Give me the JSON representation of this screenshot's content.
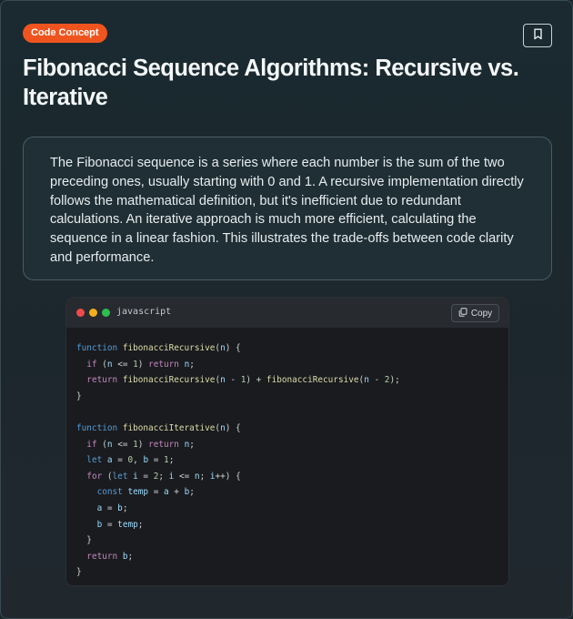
{
  "badge": "Code Concept",
  "title": "Fibonacci Sequence Algorithms: Recursive vs. Iterative",
  "description": "The Fibonacci sequence is a series where each number is the sum of the two preceding ones, usually starting with 0 and 1. A recursive implementation directly follows the mathematical definition, but it's inefficient due to redundant calculations. An iterative approach is much more efficient, calculating the sequence in a linear fashion. This illustrates the trade-offs between code clarity and performance.",
  "code_block": {
    "language": "javascript",
    "copy_label": "Copy",
    "lines": [
      [
        [
          "kw2",
          "function "
        ],
        [
          "fn",
          "fibonacciRecursive"
        ],
        [
          "p",
          "("
        ],
        [
          "var",
          "n"
        ],
        [
          "p",
          ") {"
        ]
      ],
      [
        [
          "p",
          "  "
        ],
        [
          "kw",
          "if"
        ],
        [
          "p",
          " ("
        ],
        [
          "var",
          "n"
        ],
        [
          "p",
          " <= "
        ],
        [
          "num",
          "1"
        ],
        [
          "p",
          ") "
        ],
        [
          "kw",
          "return"
        ],
        [
          "p",
          " "
        ],
        [
          "var",
          "n"
        ],
        [
          "p",
          ";"
        ]
      ],
      [
        [
          "p",
          "  "
        ],
        [
          "kw",
          "return"
        ],
        [
          "p",
          " "
        ],
        [
          "fn",
          "fibonacciRecursive"
        ],
        [
          "p",
          "("
        ],
        [
          "var",
          "n"
        ],
        [
          "p",
          " - "
        ],
        [
          "num",
          "1"
        ],
        [
          "p",
          ") + "
        ],
        [
          "fn",
          "fibonacciRecursive"
        ],
        [
          "p",
          "("
        ],
        [
          "var",
          "n"
        ],
        [
          "p",
          " - "
        ],
        [
          "num",
          "2"
        ],
        [
          "p",
          ");"
        ]
      ],
      [
        [
          "p",
          "}"
        ]
      ],
      [],
      [
        [
          "kw2",
          "function "
        ],
        [
          "fn",
          "fibonacciIterative"
        ],
        [
          "p",
          "("
        ],
        [
          "var",
          "n"
        ],
        [
          "p",
          ") {"
        ]
      ],
      [
        [
          "p",
          "  "
        ],
        [
          "kw",
          "if"
        ],
        [
          "p",
          " ("
        ],
        [
          "var",
          "n"
        ],
        [
          "p",
          " <= "
        ],
        [
          "num",
          "1"
        ],
        [
          "p",
          ") "
        ],
        [
          "kw",
          "return"
        ],
        [
          "p",
          " "
        ],
        [
          "var",
          "n"
        ],
        [
          "p",
          ";"
        ]
      ],
      [
        [
          "p",
          "  "
        ],
        [
          "kw2",
          "let"
        ],
        [
          "p",
          " "
        ],
        [
          "var",
          "a"
        ],
        [
          "p",
          " = "
        ],
        [
          "num",
          "0"
        ],
        [
          "p",
          ", "
        ],
        [
          "var",
          "b"
        ],
        [
          "p",
          " = "
        ],
        [
          "num",
          "1"
        ],
        [
          "p",
          ";"
        ]
      ],
      [
        [
          "p",
          "  "
        ],
        [
          "kw",
          "for"
        ],
        [
          "p",
          " ("
        ],
        [
          "kw2",
          "let"
        ],
        [
          "p",
          " "
        ],
        [
          "var",
          "i"
        ],
        [
          "p",
          " = "
        ],
        [
          "num",
          "2"
        ],
        [
          "p",
          "; "
        ],
        [
          "var",
          "i"
        ],
        [
          "p",
          " <= "
        ],
        [
          "var",
          "n"
        ],
        [
          "p",
          "; "
        ],
        [
          "var",
          "i"
        ],
        [
          "p",
          "++) {"
        ]
      ],
      [
        [
          "p",
          "    "
        ],
        [
          "kw2",
          "const"
        ],
        [
          "p",
          " "
        ],
        [
          "var",
          "temp"
        ],
        [
          "p",
          " = "
        ],
        [
          "var",
          "a"
        ],
        [
          "p",
          " + "
        ],
        [
          "var",
          "b"
        ],
        [
          "p",
          ";"
        ]
      ],
      [
        [
          "p",
          "    "
        ],
        [
          "var",
          "a"
        ],
        [
          "p",
          " = "
        ],
        [
          "var",
          "b"
        ],
        [
          "p",
          ";"
        ]
      ],
      [
        [
          "p",
          "    "
        ],
        [
          "var",
          "b"
        ],
        [
          "p",
          " = "
        ],
        [
          "var",
          "temp"
        ],
        [
          "p",
          ";"
        ]
      ],
      [
        [
          "p",
          "  }"
        ]
      ],
      [
        [
          "p",
          "  "
        ],
        [
          "kw",
          "return"
        ],
        [
          "p",
          " "
        ],
        [
          "var",
          "b"
        ],
        [
          "p",
          ";"
        ]
      ],
      [
        [
          "p",
          "}"
        ]
      ]
    ]
  },
  "icons": {
    "bookmark": "bookmark-icon",
    "copy": "copy-icon"
  },
  "colors": {
    "badge_bg": "#f0541e",
    "dot_red": "#ee4b4b",
    "dot_yellow": "#f2b01c",
    "dot_green": "#2ebd4f"
  }
}
